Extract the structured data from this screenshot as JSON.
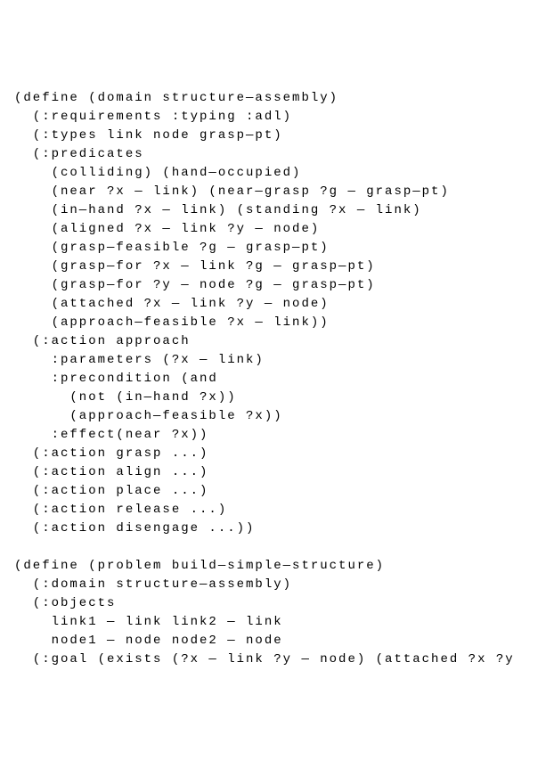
{
  "lines": [
    "(define (domain structure—assembly)",
    "  (:requirements :typing :adl)",
    "  (:types link node grasp—pt)",
    "  (:predicates",
    "    (colliding) (hand—occupied)",
    "    (near ?x — link) (near—grasp ?g — grasp—pt)",
    "    (in—hand ?x — link) (standing ?x — link)",
    "    (aligned ?x — link ?y — node)",
    "    (grasp—feasible ?g — grasp—pt)",
    "    (grasp—for ?x — link ?g — grasp—pt)",
    "    (grasp—for ?y — node ?g — grasp—pt)",
    "    (attached ?x — link ?y — node)",
    "    (approach—feasible ?x — link))",
    "  (:action approach",
    "    :parameters (?x — link)",
    "    :precondition (and",
    "      (not (in—hand ?x))",
    "      (approach—feasible ?x))",
    "    :effect(near ?x))",
    "  (:action grasp ...)",
    "  (:action align ...)",
    "  (:action place ...)",
    "  (:action release ...)",
    "  (:action disengage ...))",
    "",
    "(define (problem build—simple—structure)",
    "  (:domain structure—assembly)",
    "  (:objects",
    "    link1 — link link2 — link",
    "    node1 — node node2 — node",
    "  (:goal (exists (?x — link ?y — node) (attached ?x ?y"
  ]
}
